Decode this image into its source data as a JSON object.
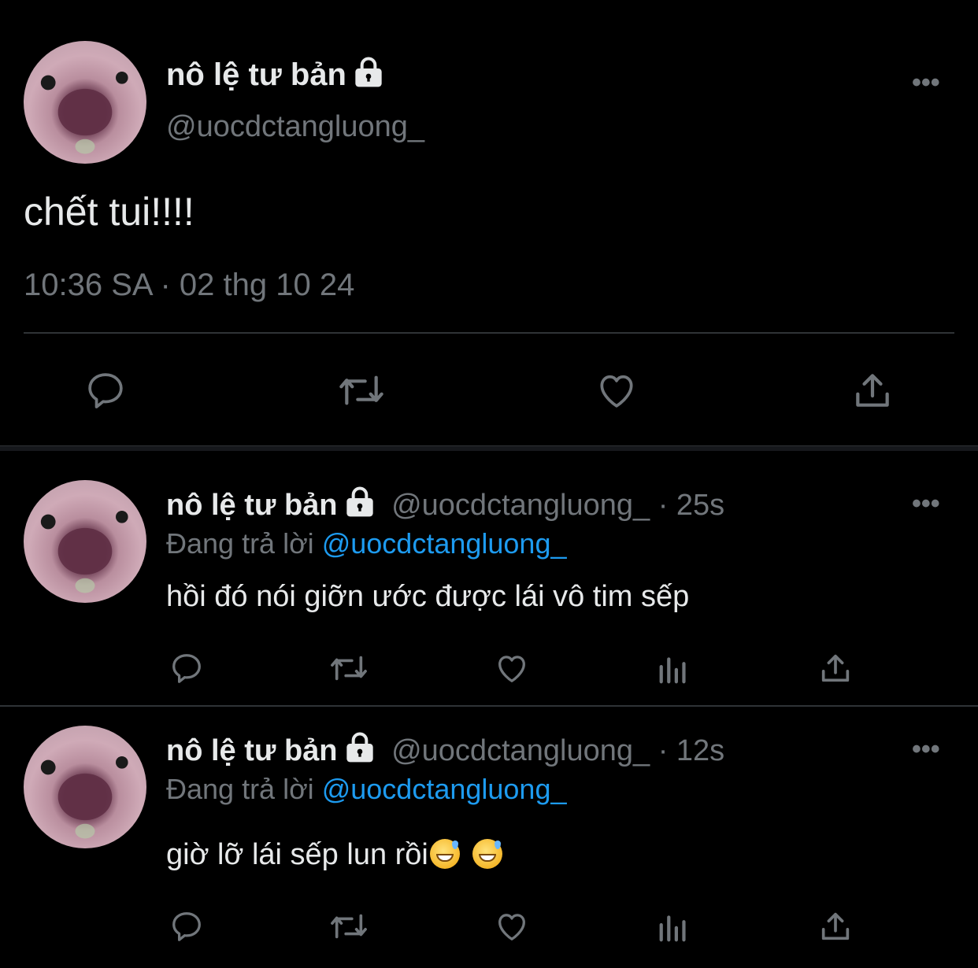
{
  "main_tweet": {
    "display_name": "nô lệ tư bản",
    "handle": "@uocdctangluong_",
    "text": "chết tui!!!!",
    "timestamp": "10:36 SA · 02 thg 10 24",
    "more_label": "•••",
    "actions": [
      "reply-icon",
      "retweet-icon",
      "like-icon",
      "share-icon"
    ]
  },
  "replies": [
    {
      "display_name": "nô lệ tư bản",
      "handle": "@uocdctangluong_",
      "time": "· 25s",
      "replying_prefix": "Đang trả lời",
      "replying_to": "@uocdctangluong_",
      "text": "hồi đó nói giỡn ước được lái vô tim sếp",
      "more_label": "•••",
      "actions": [
        "reply-icon",
        "retweet-icon",
        "like-icon",
        "analytics-icon",
        "share-icon"
      ]
    },
    {
      "display_name": "nô lệ tư bản",
      "handle": "@uocdctangluong_",
      "time": "· 12s",
      "replying_prefix": "Đang trả lời",
      "replying_to": "@uocdctangluong_",
      "text": "giờ lỡ lái sếp lun rồi",
      "more_label": "•••",
      "actions": [
        "reply-icon",
        "retweet-icon",
        "like-icon",
        "analytics-icon",
        "share-icon"
      ]
    }
  ],
  "colors": {
    "background": "#000000",
    "text": "#e7e9ea",
    "secondary": "#71767b",
    "link": "#1d9bf0",
    "divider": "#2f3336"
  }
}
